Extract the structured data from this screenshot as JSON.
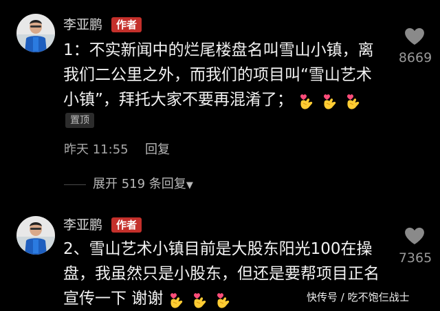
{
  "comments": [
    {
      "username": "李亚鹏",
      "badge": "作者",
      "lines": [
        "1：不实新闻中的烂尾楼盘名叫雪山小镇，离",
        "我们二公里之外，而我们的项目叫“雪山艺术",
        "小镇”，拜托大家不要再混淆了；"
      ],
      "emoji": [
        "heart-hand-icon",
        "heart-hand-icon",
        "heart-hand-icon"
      ],
      "pinned_label": "置顶",
      "time": "昨天 11:55",
      "reply_label": "回复",
      "expand_label": "展开 519 条回复",
      "likes": "8669"
    },
    {
      "username": "李亚鹏",
      "badge": "作者",
      "lines": [
        "2、雪山艺术小镇目前是大股东阳光100在操",
        "盘，我虽然只是小股东，但还是要帮项目正名",
        "宣传一下 谢谢"
      ],
      "emoji": [
        "heart-hand-icon",
        "heart-hand-icon",
        "heart-hand-icon"
      ],
      "likes": "7365"
    }
  ],
  "watermark": "快传号 / 吃不饱仨战士",
  "colors": {
    "background": "#000000",
    "badge": "#c4302b",
    "heart_emoji": "#ffcc33",
    "heart_pink": "#ff4d7a"
  }
}
